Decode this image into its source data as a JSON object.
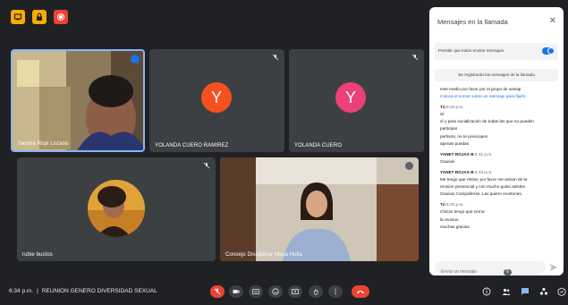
{
  "participants": [
    {
      "name": "Sandra Ropi Lozano"
    },
    {
      "name": "YOLANDA CUERO RAMIREZ",
      "initial": "Y",
      "color": "#f4511e"
    },
    {
      "name": "YOLANDA CUERO",
      "initial": "Y",
      "color": "#ec407a"
    },
    {
      "name": "rubie bustos"
    },
    {
      "name": "Consejo Disciplinar Mesa Huila"
    }
  ],
  "chat_panel": {
    "title": "Mensajes en la llamada",
    "allow_label": "Permitir que todos envíen mensajes",
    "notice": "Se registrarán los mensajes de la llamada",
    "messages_top": [
      "este medio por favor por el grupo de wasap",
      "Coloca el cursor sobre un mensaje para fijarlo"
    ],
    "groups": [
      {
        "sender": "Tú",
        "time": "6:33 p.m.",
        "lines": [
          "Sí",
          "sí y para socialización de todas las que no pueden",
          "participar",
          "perfecto, no te preocupes",
          "apenas puedas"
        ]
      },
      {
        "sender": "YANET ROJAS B",
        "time": "6:31 p.m.",
        "lines": [
          "Gracias"
        ]
      },
      {
        "sender": "YANET ROJAS B",
        "time": "6:33 p.m.",
        "lines": [
          "Me tengo que retirar, por favor me avisan de la",
          "reunion presencial y con mucho gusto asistire.",
          "Gracias Compañeras, Las quiero montones."
        ]
      },
      {
        "sender": "Tú",
        "time": "6:33 p.m.",
        "lines": [
          "Chicas tengo que cerrar",
          "la reunion",
          "muchas gracias"
        ]
      }
    ],
    "compose_placeholder": "Envía un mensaje"
  },
  "bottom_bar": {
    "time": "6:34 p.m.",
    "separator": "|",
    "meeting_name": "REUNION GENERO DIVERSIDAD SEXUAL",
    "participant_count": "6"
  },
  "colors": {
    "background": "#202124",
    "tile": "#3c4043",
    "danger": "#ea4335",
    "accent": "#1a73e8"
  }
}
